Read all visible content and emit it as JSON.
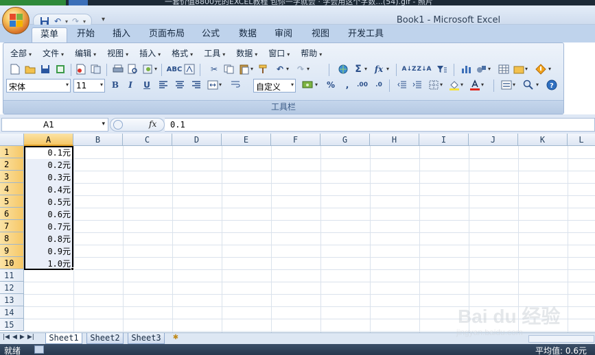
{
  "window": {
    "title": "Book1 - Microsoft Excel",
    "background_strip_text": "一套价值8800元的EXCEL教程 包你一学就会 · 学会用这个字数...(54).gif - 照片"
  },
  "quick_access": {
    "icons": [
      "save-icon",
      "undo-icon",
      "redo-icon"
    ],
    "more_label": "▾"
  },
  "tabs": [
    {
      "label": "菜单",
      "active": true
    },
    {
      "label": "开始"
    },
    {
      "label": "插入"
    },
    {
      "label": "页面布局"
    },
    {
      "label": "公式"
    },
    {
      "label": "数据"
    },
    {
      "label": "审阅"
    },
    {
      "label": "视图"
    },
    {
      "label": "开发工具"
    }
  ],
  "classic_menu": {
    "items": [
      "全部",
      "文件",
      "编辑",
      "视图",
      "插入",
      "格式",
      "工具",
      "数据",
      "窗口",
      "帮助"
    ]
  },
  "toolbar": {
    "font_name": "宋体",
    "font_size": "11",
    "number_format": "自定义",
    "bold": "B",
    "italic": "I",
    "underline": "U",
    "percent": "%",
    "comma": ",",
    "increase_decimal": ".00",
    "decrease_decimal": ".0",
    "sum": "Σ",
    "fx": "fx",
    "group_label": "工具栏"
  },
  "formula_bar": {
    "name_box": "A1",
    "fx_label": "fx",
    "value": "0.1"
  },
  "grid": {
    "columns": [
      "A",
      "B",
      "C",
      "D",
      "E",
      "F",
      "G",
      "H",
      "I",
      "J",
      "K",
      "L"
    ],
    "rows": [
      "1",
      "2",
      "3",
      "4",
      "5",
      "6",
      "7",
      "8",
      "9",
      "10",
      "11",
      "12",
      "13",
      "14",
      "15"
    ],
    "selected_column": "A",
    "active_cell": "A1",
    "column_a_values": [
      "0.1元",
      "0.2元",
      "0.3元",
      "0.4元",
      "0.5元",
      "0.6元",
      "0.7元",
      "0.8元",
      "0.9元",
      "1.0元"
    ]
  },
  "sheets": [
    {
      "name": "Sheet1",
      "active": true
    },
    {
      "name": "Sheet2"
    },
    {
      "name": "Sheet3"
    }
  ],
  "status_bar": {
    "ready": "就绪",
    "average": "平均值: 0.6元"
  },
  "watermark": {
    "brand": "Bai du 经验",
    "url": "jingyan.baidu.com"
  },
  "colors": {
    "selection_header": "#f6c766",
    "ribbon_bg": "#d9e5f4",
    "status_bar": "#27384e"
  }
}
